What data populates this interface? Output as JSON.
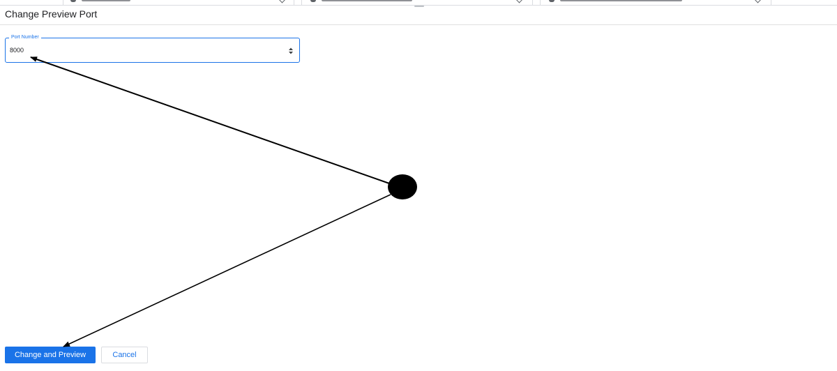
{
  "dialog": {
    "title": "Change Preview Port"
  },
  "port_field": {
    "label": "Port Number",
    "value": "8000"
  },
  "actions": {
    "primary_label": "Change and Preview",
    "cancel_label": "Cancel"
  },
  "colors": {
    "accent": "#1a73e8",
    "annotation": "#000000"
  },
  "icons": {
    "spinner": "up-down-spinner-icon",
    "tab_chevron": "chevron-down-icon"
  }
}
